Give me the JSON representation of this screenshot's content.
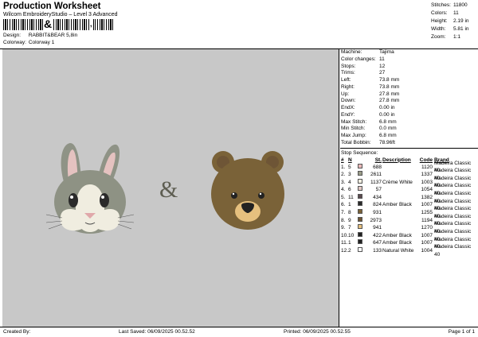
{
  "header": {
    "title": "Production Worksheet",
    "subtitle": "Wilcom EmbroideryStudio – Level 3 Advanced",
    "barcode_text": "&",
    "barcode_tail": ",",
    "design_label": "Design:",
    "design_value": "RABBIT&BEAR 5,8in",
    "colorway_label": "Colorway:",
    "colorway_value": "Colorway 1"
  },
  "stats": [
    {
      "label": "Stitches:",
      "value": "11800"
    },
    {
      "label": "Colors:",
      "value": "11"
    },
    {
      "label": "Height:",
      "value": "2.19 in"
    },
    {
      "label": "Width:",
      "value": "5.81 in"
    },
    {
      "label": "Zoom:",
      "value": "1:1"
    }
  ],
  "machine_info": [
    {
      "label": "Machine:",
      "value": "Tajima"
    },
    {
      "label": "Color changes:",
      "value": "11"
    },
    {
      "label": "Stops:",
      "value": "12"
    },
    {
      "label": "Trims:",
      "value": "27"
    },
    {
      "label": "Left:",
      "value": "73.8 mm"
    },
    {
      "label": "Right:",
      "value": "73.8 mm"
    },
    {
      "label": "Up:",
      "value": "27.8 mm"
    },
    {
      "label": "Down:",
      "value": "27.8 mm"
    },
    {
      "label": "EndX:",
      "value": "0.00 in"
    },
    {
      "label": "EndY:",
      "value": "0.00 in"
    },
    {
      "label": "Max Stitch:",
      "value": "6.8 mm"
    },
    {
      "label": "Min Stitch:",
      "value": "0.0 mm"
    },
    {
      "label": "Max Jump:",
      "value": "6.8 mm"
    },
    {
      "label": "Total Bobbin:",
      "value": "78.96ft"
    }
  ],
  "stop_sequence": {
    "title": "Stop Sequence:",
    "columns": [
      "#",
      "N",
      "",
      "St.",
      "Description",
      "Code",
      "Brand"
    ],
    "rows": [
      {
        "n": "1.",
        "needle": "5",
        "color": "#e8b8b8",
        "st": "688",
        "desc": "",
        "code": "1120",
        "brand": "Madeira Classic 40"
      },
      {
        "n": "2.",
        "needle": "3",
        "color": "#9a9c88",
        "st": "2611",
        "desc": "",
        "code": "1337",
        "brand": "Madeira Classic 40"
      },
      {
        "n": "3.",
        "needle": "4",
        "color": "#f4f0e2",
        "st": "1137",
        "desc": "Crème White",
        "code": "1003",
        "brand": "Madeira Classic 40"
      },
      {
        "n": "4.",
        "needle": "6",
        "color": "#e2c9c4",
        "st": "57",
        "desc": "",
        "code": "1054",
        "brand": "Madeira Classic 40"
      },
      {
        "n": "5.",
        "needle": "11",
        "color": "#5a4a4e",
        "st": "434",
        "desc": "",
        "code": "1382",
        "brand": "Madeira Classic 40"
      },
      {
        "n": "6.",
        "needle": "1",
        "color": "#2a2a2a",
        "st": "824",
        "desc": "Amber Black",
        "code": "1007",
        "brand": "Madeira Classic 40"
      },
      {
        "n": "7.",
        "needle": "8",
        "color": "#7a6238",
        "st": "931",
        "desc": "",
        "code": "1255",
        "brand": "Madeira Classic 40"
      },
      {
        "n": "8.",
        "needle": "9",
        "color": "#6e5536",
        "st": "2973",
        "desc": "",
        "code": "1194",
        "brand": "Madeira Classic 40"
      },
      {
        "n": "9.",
        "needle": "7",
        "color": "#e6c07e",
        "st": "941",
        "desc": "",
        "code": "1270",
        "brand": "Madeira Classic 40"
      },
      {
        "n": "10.",
        "needle": "10",
        "color": "#222222",
        "st": "422",
        "desc": "Amber Black",
        "code": "1007",
        "brand": "Madeira Classic 40"
      },
      {
        "n": "11.",
        "needle": "1",
        "color": "#222222",
        "st": "647",
        "desc": "Amber Black",
        "code": "1007",
        "brand": "Madeira Classic 40"
      },
      {
        "n": "12.",
        "needle": "2",
        "color": "#ffffff",
        "st": "133",
        "desc": "Natural White",
        "code": "1004",
        "brand": "Madeira Classic 40"
      }
    ]
  },
  "design": {
    "ampersand": "&"
  },
  "footer": {
    "created_by": "Created By:",
    "last_saved": "Last Saved: 06/09/2025 00.52.52",
    "printed": "Printed: 06/09/2025 00.52.55",
    "page": "Page 1 of 1"
  }
}
